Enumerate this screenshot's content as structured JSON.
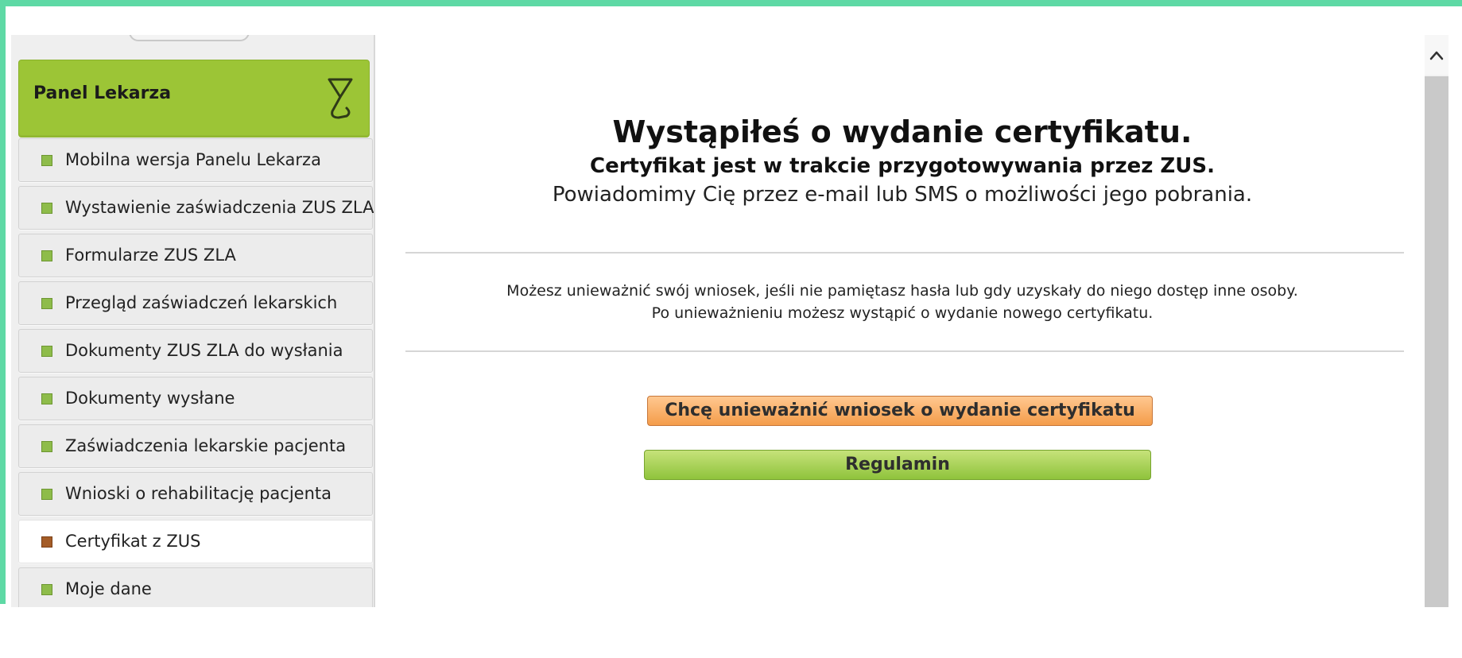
{
  "sidebar": {
    "header": {
      "title": "Panel Lekarza",
      "icon": "hourglass-icon"
    },
    "items": [
      {
        "label": "Mobilna wersja Panelu Lekarza",
        "active": false
      },
      {
        "label": "Wystawienie zaświadczenia ZUS ZLA",
        "active": false
      },
      {
        "label": "Formularze ZUS ZLA",
        "active": false
      },
      {
        "label": "Przegląd zaświadczeń lekarskich",
        "active": false
      },
      {
        "label": "Dokumenty ZUS ZLA do wysłania",
        "active": false
      },
      {
        "label": "Dokumenty wysłane",
        "active": false
      },
      {
        "label": "Zaświadczenia lekarskie pacjenta",
        "active": false
      },
      {
        "label": "Wnioski o rehabilitację pacjenta",
        "active": false
      },
      {
        "label": "Certyfikat z ZUS",
        "active": true
      },
      {
        "label": "Moje dane",
        "active": false
      }
    ]
  },
  "main": {
    "title": "Wystąpiłeś o wydanie certyfikatu.",
    "subtitle": "Certyfikat jest w trakcie przygotowywania przez ZUS.",
    "notice": "Powiadomimy Cię przez e-mail lub SMS o możliwości jego pobrania.",
    "info_line1": "Możesz unieważnić swój wniosek, jeśli nie pamiętasz hasła lub gdy uzyskały do niego dostęp inne osoby.",
    "info_line2": "Po unieważnieniu możesz wystąpić o wydanie nowego certyfikatu.",
    "cancel_button": "Chcę unieważnić wniosek o wydanie certyfikatu",
    "terms_button": "Regulamin"
  },
  "colors": {
    "accent_strip": "#5ed9a5",
    "panel_header": "#9cc536",
    "cancel_button": "#f49c4a",
    "terms_button": "#8fc33c"
  }
}
